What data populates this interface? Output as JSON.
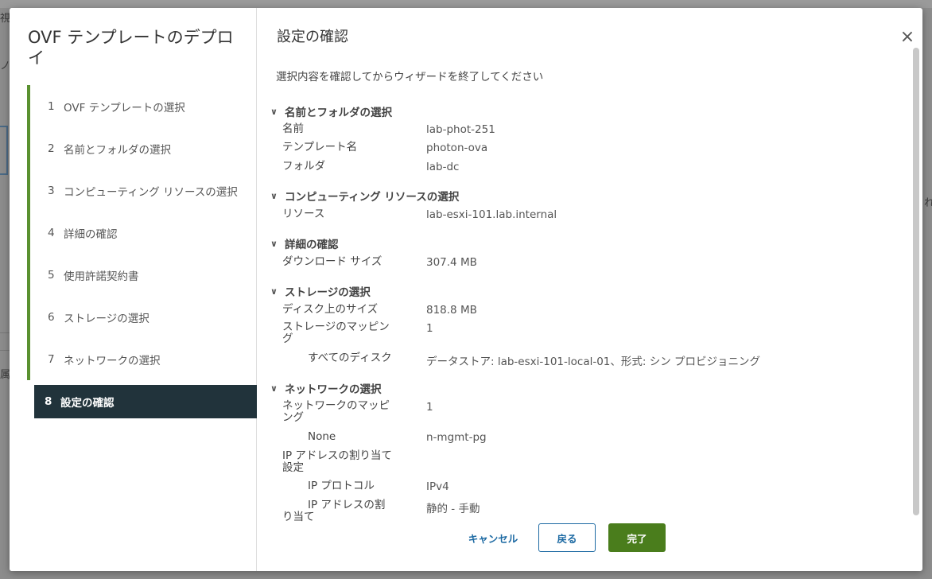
{
  "background": {
    "fragments": [
      "視",
      "ノ",
      "れ",
      "属"
    ]
  },
  "wizard": {
    "title": "OVF テンプレートのデプロイ",
    "steps": [
      {
        "num": "1",
        "label": "OVF テンプレートの選択"
      },
      {
        "num": "2",
        "label": "名前とフォルダの選択"
      },
      {
        "num": "3",
        "label": "コンピューティング リソースの選択"
      },
      {
        "num": "4",
        "label": "詳細の確認"
      },
      {
        "num": "5",
        "label": "使用許諾契約書"
      },
      {
        "num": "6",
        "label": "ストレージの選択"
      },
      {
        "num": "7",
        "label": "ネットワークの選択"
      },
      {
        "num": "8",
        "label": "設定の確認"
      }
    ],
    "active_step": 8,
    "accent_color": "#5a9130"
  },
  "page": {
    "title": "設定の確認",
    "intro": "選択内容を確認してからウィザードを終了してください"
  },
  "summary": {
    "name_folder": {
      "heading": "名前とフォルダの選択",
      "name_label": "名前",
      "name_value": "lab-phot-251",
      "template_label": "テンプレート名",
      "template_value": "photon-ova",
      "folder_label": "フォルダ",
      "folder_value": "lab-dc"
    },
    "compute": {
      "heading": "コンピューティング リソースの選択",
      "resource_label": "リソース",
      "resource_value": "lab-esxi-101.lab.internal"
    },
    "details": {
      "heading": "詳細の確認",
      "download_label": "ダウンロード サイズ",
      "download_value": "307.4 MB"
    },
    "storage": {
      "heading": "ストレージの選択",
      "disk_size_label": "ディスク上のサイズ",
      "disk_size_value": "818.8 MB",
      "mapping_label_1": "ストレージのマッピン",
      "mapping_label_2": "グ",
      "mapping_value": "1",
      "all_disks_label": "すべてのディスク",
      "all_disks_value": "データストア: lab-esxi-101-local-01、形式: シン プロビジョニング"
    },
    "network": {
      "heading": "ネットワークの選択",
      "mapping_label_1": "ネットワークのマッピ",
      "mapping_label_2": "ング",
      "mapping_value": "1",
      "none_label": "None",
      "none_value": "n-mgmt-pg",
      "ip_alloc_label_1": "IP アドレスの割り当て",
      "ip_alloc_label_2": "設定",
      "ip_protocol_label": "IP プロトコル",
      "ip_protocol_value": "IPv4",
      "ip_assign_label_1": "IP アドレスの割",
      "ip_assign_label_2": "り当て",
      "ip_assign_value": "静的 - 手動"
    }
  },
  "footer": {
    "cancel": "キャンセル",
    "back": "戻る",
    "finish": "完了",
    "primary_color": "#4a7d1c"
  },
  "close_glyph": "×",
  "chevron_glyph": "∨"
}
